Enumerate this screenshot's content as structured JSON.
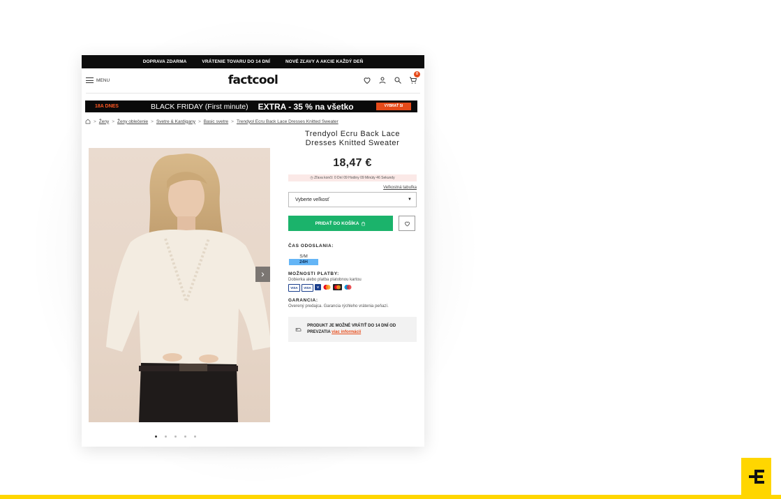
{
  "topbar": {
    "items": [
      "DOPRAVA ZDARMA",
      "VRÁTENIE TOVARU DO 14 DNÍ",
      "NOVÉ ZĽAVY A AKCIE KAŽDÝ DEŇ"
    ]
  },
  "header": {
    "menu_label": "MENU",
    "logo_text": "factcool",
    "cart_count": "0"
  },
  "promo": {
    "days": "18A DNES",
    "headline": "BLACK FRIDAY (First minute)",
    "extra": "EXTRA - 35 % na všetko",
    "cta": "VYBRAŤ SI"
  },
  "breadcrumb": {
    "items": [
      "Ženy",
      "Ženy oblečenie",
      "Svetre & Kardigany",
      "Basic svetre",
      "Trendyol Ecru Back Lace Dresses Knitted Sweater"
    ]
  },
  "product": {
    "title": "Trendyol Ecru Back Lace Dresses Knitted Sweater",
    "price": "18,47 €",
    "timer": "Zľava končí: 0 Dní 09 Hodiny 09 Minúty 46 Sekundy",
    "size_chart": "Veľkostná tabuľka",
    "size_placeholder": "Vyberte veľkosť",
    "add_to_cart": "PRIDAŤ DO KOŠÍKA",
    "image_count": 5,
    "active_image": 1
  },
  "shipping": {
    "label": "ČAS ODOSLANIA:",
    "size": "S/M",
    "time": "24H"
  },
  "payment": {
    "label": "MOŽNOSTI PLATBY:",
    "text": "Dobierka alebo platba platobnou kartou",
    "cards": [
      "VISA",
      "VISA",
      "V",
      "MC",
      "MC",
      "MAESTRO"
    ]
  },
  "guarantee": {
    "label": "GARANCIA:",
    "text": "Overený predajca. Garancia rýchleho vrátenia peňazí."
  },
  "return_box": {
    "text": "PRODUKT JE MOŽNÉ VRÁTIŤ DO 14 DNÍ OD PREVZATIA",
    "link": "viac informácií"
  },
  "colors": {
    "accent_green": "#1bb36b",
    "accent_orange": "#e64a19",
    "brand_yellow": "#ffd600"
  }
}
